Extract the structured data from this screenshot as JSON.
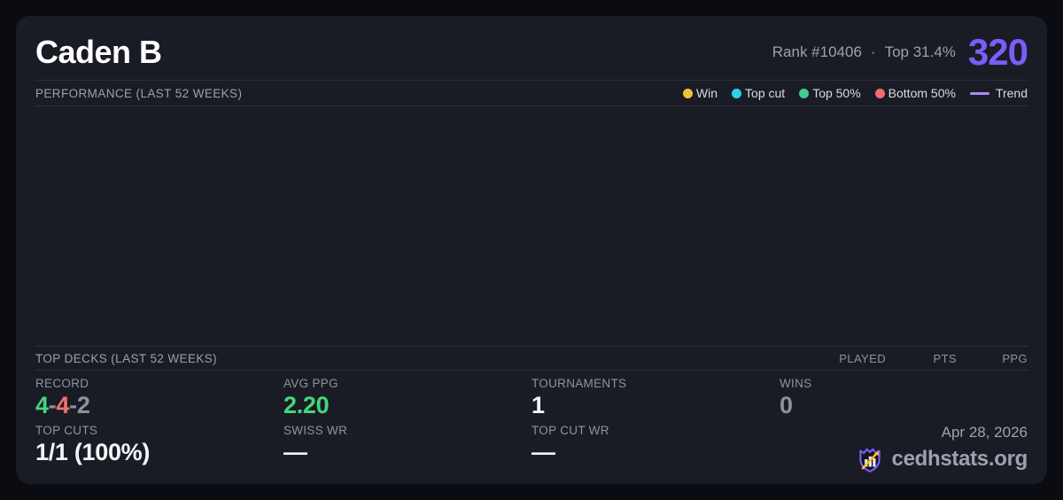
{
  "theme": {
    "page_bg": "#0b0c11",
    "card_bg": "#1a1c25",
    "divider": "#2b2f3a",
    "accent_purple": "#7c5cfa",
    "trend_purple": "#a78bfa",
    "win_gold": "#f2c230",
    "top_cut_cyan": "#2fd0e8",
    "top50_green": "#3ecf8e",
    "bottom50_red": "#f26d6d",
    "record_green": "#42d77d",
    "record_red": "#f47272",
    "muted_gray": "#8b919d"
  },
  "header": {
    "player_name": "Caden B",
    "rank": "Rank #10406",
    "separator": "·",
    "top_percent": "Top 31.4%",
    "score": "320"
  },
  "performance": {
    "section_title": "PERFORMANCE (LAST 52 WEEKS)",
    "legend": [
      {
        "label": "Win",
        "color": "#f2c230",
        "marker": "dot"
      },
      {
        "label": "Top cut",
        "color": "#2fd0e8",
        "marker": "dot"
      },
      {
        "label": "Top 50%",
        "color": "#3ecf8e",
        "marker": "dot"
      },
      {
        "label": "Bottom 50%",
        "color": "#f26d6d",
        "marker": "dot"
      },
      {
        "label": "Trend",
        "color": "#a78bfa",
        "marker": "line"
      }
    ],
    "chart_points": []
  },
  "top_decks": {
    "section_title": "TOP DECKS (LAST 52 WEEKS)",
    "columns": [
      "PLAYED",
      "PTS",
      "PPG"
    ],
    "rows": []
  },
  "stats": {
    "record": {
      "label": "RECORD",
      "wins": "4",
      "sep1": "-",
      "losses": "4",
      "sep2": "-",
      "draws": "2"
    },
    "avg_ppg": {
      "label": "AVG PPG",
      "value": "2.20"
    },
    "tournaments": {
      "label": "TOURNAMENTS",
      "value": "1"
    },
    "wins": {
      "label": "WINS",
      "value": "0"
    },
    "top_cuts": {
      "label": "TOP CUTS",
      "value": "1/1 (100%)"
    },
    "swiss_wr": {
      "label": "SWISS WR",
      "value": "—"
    },
    "top_cut_wr": {
      "label": "TOP CUT WR",
      "value": "—"
    }
  },
  "footer": {
    "date": "Apr 28, 2026",
    "brand": "cedhstats.org"
  }
}
